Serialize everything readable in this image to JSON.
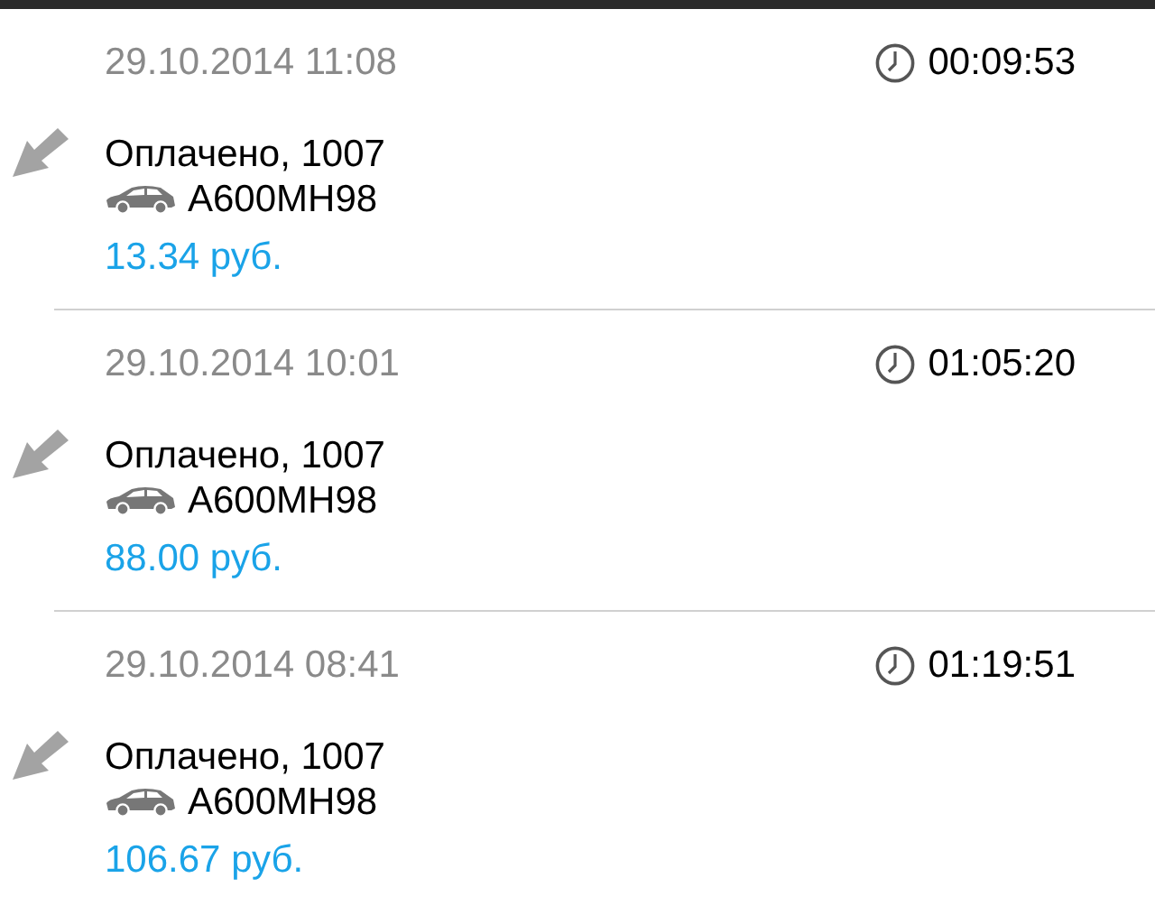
{
  "payments": [
    {
      "date": "29.10.2014 11:08",
      "duration": "00:09:53",
      "status": "Оплачено, 1007",
      "plate": "A600MH98",
      "amount": "13.34 руб."
    },
    {
      "date": "29.10.2014 10:01",
      "duration": "01:05:20",
      "status": "Оплачено, 1007",
      "plate": "A600MH98",
      "amount": "88.00 руб."
    },
    {
      "date": "29.10.2014 08:41",
      "duration": "01:19:51",
      "status": "Оплачено, 1007",
      "plate": "A600MH98",
      "amount": "106.67 руб."
    }
  ]
}
